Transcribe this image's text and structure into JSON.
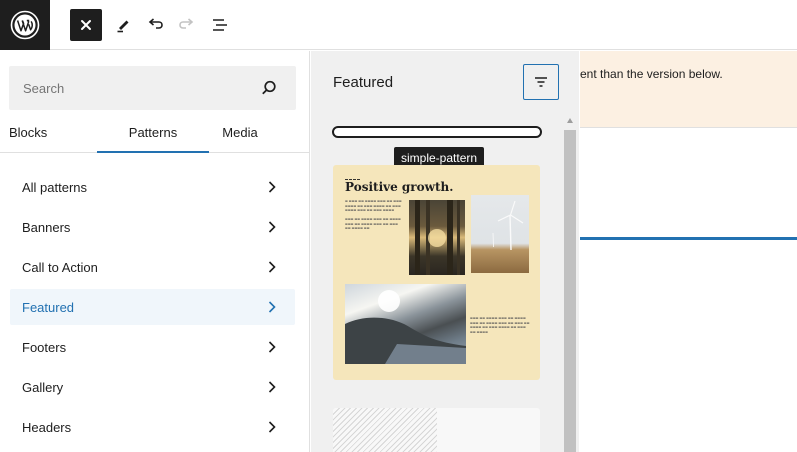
{
  "toolbar": {
    "logo_icon": "wordpress-logo",
    "close_icon": "close-icon",
    "tools_icon": "pencil-icon",
    "undo_icon": "undo-icon",
    "redo_icon": "redo-icon",
    "list_view_icon": "list-view-icon"
  },
  "sidebar": {
    "search_placeholder": "Search",
    "tabs": [
      {
        "label": "Blocks"
      },
      {
        "label": "Patterns",
        "active": true
      },
      {
        "label": "Media"
      }
    ],
    "categories": [
      {
        "label": "All patterns"
      },
      {
        "label": "Banners"
      },
      {
        "label": "Call to Action"
      },
      {
        "label": "Featured",
        "active": true
      },
      {
        "label": "Footers"
      },
      {
        "label": "Gallery"
      },
      {
        "label": "Headers"
      }
    ]
  },
  "panel": {
    "title": "Featured",
    "tooltip": "simple-pattern",
    "card": {
      "title": "Positive growth."
    }
  },
  "canvas": {
    "notice_text": "ent than the version below."
  },
  "colors": {
    "accent": "#2271b1",
    "dark": "#1e1e1e",
    "card_bg": "#f5e6bb",
    "notice_bg": "#fcf0e2"
  }
}
